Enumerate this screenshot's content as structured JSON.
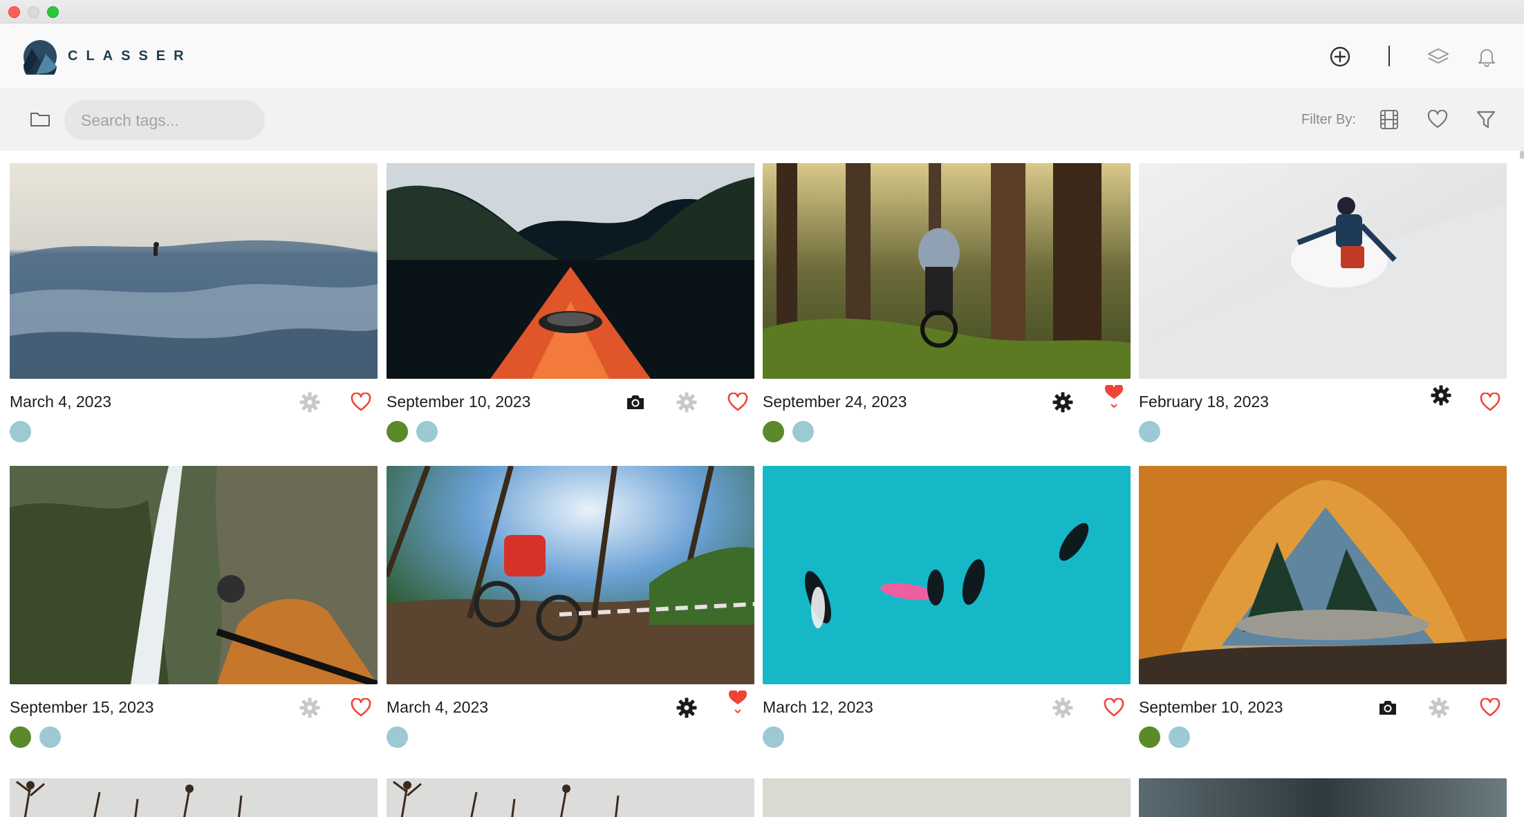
{
  "app": {
    "brand": "CLASSER"
  },
  "toolbar": {
    "search_placeholder": "Search tags...",
    "filter_label": "Filter By:"
  },
  "colors": {
    "heart": "#f04438",
    "tag_green": "#5a8a2a",
    "tag_blue": "#9cc9d3",
    "gear_inactive": "#c8c8c8",
    "gear_active": "#1a1a1a"
  },
  "photos": [
    {
      "date": "March 4, 2023",
      "scene": "surf-wave",
      "camera": false,
      "gear": "inactive",
      "heart": "outline",
      "tags": [
        "blue"
      ]
    },
    {
      "date": "September 10, 2023",
      "scene": "kayak-fjord",
      "camera": true,
      "gear": "inactive",
      "heart": "outline",
      "tags": [
        "green",
        "blue"
      ]
    },
    {
      "date": "September 24, 2023",
      "scene": "forest-bike",
      "camera": false,
      "gear": "active",
      "heart": "filled",
      "tags": [
        "green",
        "blue"
      ]
    },
    {
      "date": "February 18, 2023",
      "scene": "snow-ski",
      "camera": false,
      "gear": "active",
      "heart": "outline",
      "tags": [
        "blue"
      ]
    },
    {
      "date": "September 15, 2023",
      "scene": "waterfall-selfie",
      "camera": false,
      "gear": "inactive",
      "heart": "outline",
      "tags": [
        "green",
        "blue"
      ]
    },
    {
      "date": "March 4, 2023",
      "scene": "mtb-fisheye",
      "camera": false,
      "gear": "active",
      "heart": "filled",
      "tags": [
        "blue"
      ]
    },
    {
      "date": "March 12, 2023",
      "scene": "turquoise-surfers",
      "camera": false,
      "gear": "inactive",
      "heart": "outline",
      "tags": [
        "blue"
      ]
    },
    {
      "date": "September 10, 2023",
      "scene": "tent-view",
      "camera": true,
      "gear": "inactive",
      "heart": "outline",
      "tags": [
        "green",
        "blue"
      ]
    },
    {
      "date": "",
      "scene": "plants-grey",
      "camera": false,
      "gear": "",
      "heart": "",
      "tags": []
    },
    {
      "date": "",
      "scene": "plants-grey",
      "camera": false,
      "gear": "",
      "heart": "",
      "tags": []
    },
    {
      "date": "",
      "scene": "pale-mist",
      "camera": false,
      "gear": "",
      "heart": "",
      "tags": []
    },
    {
      "date": "",
      "scene": "dark-blur",
      "camera": false,
      "gear": "",
      "heart": "",
      "tags": []
    }
  ]
}
